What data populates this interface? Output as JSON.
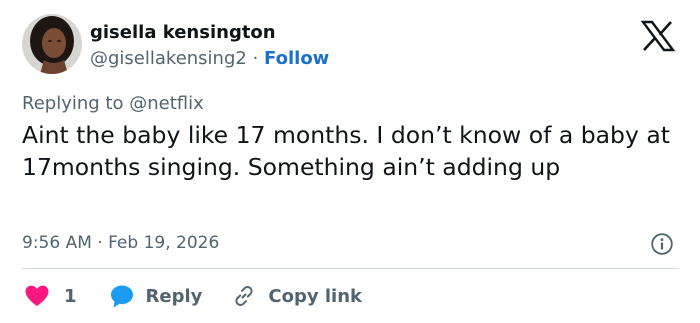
{
  "user": {
    "name": "gisella kensington",
    "handle": "@gisellakensing2",
    "separator": "·",
    "follow_label": "Follow",
    "avatar_icon": "user-avatar-photo"
  },
  "reply_context": {
    "prefix": "Replying to",
    "mention": "@netflix"
  },
  "tweet": {
    "text": "Aint the baby like 17 months. I don’t know of a baby at 17months singing. Something ain’t adding up",
    "timestamp": "9:56 AM · Feb 19, 2026"
  },
  "actions": {
    "like_count": "1",
    "reply_label": "Reply",
    "copy_label": "Copy link"
  },
  "icons": {
    "logo": "x-logo-icon",
    "info": "info-icon",
    "like": "heart-icon",
    "reply": "speech-bubble-icon",
    "copy": "link-icon"
  },
  "colors": {
    "text": "#0f1419",
    "secondary": "#536471",
    "link": "#1d6fc9",
    "like": "#f91880",
    "reply": "#1d9bf0",
    "divider": "#cfd9de"
  }
}
